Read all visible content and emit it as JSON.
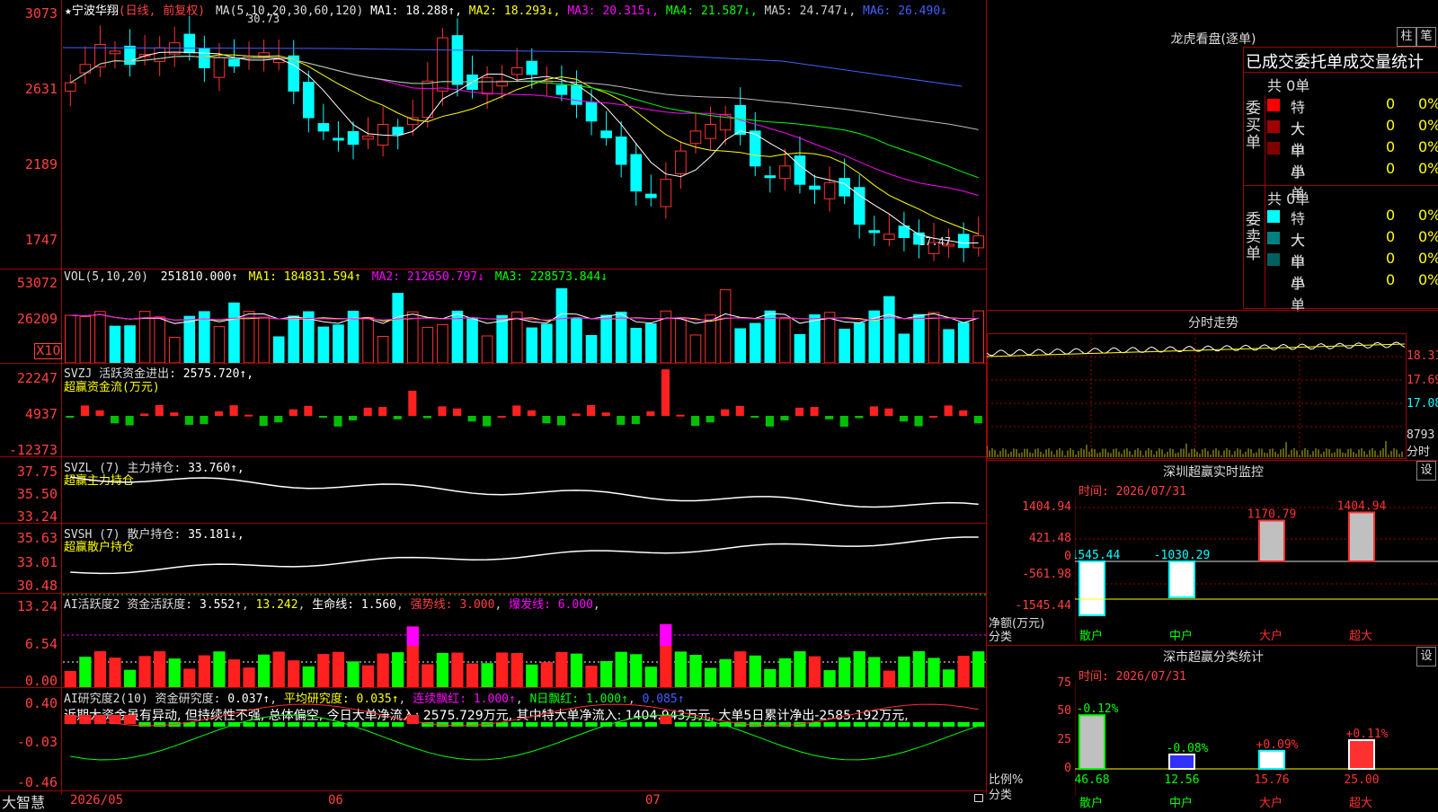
{
  "stock": {
    "name": "★宁波华翔",
    "mode": "(日线, 前复权)"
  },
  "ma_header": {
    "label": "MA(5,10,20,30,60,120)",
    "items": [
      {
        "t": "MA1: 18.288↑",
        "c": "#ffffff"
      },
      {
        "t": "MA2: 18.293↓",
        "c": "#ffff00"
      },
      {
        "t": "MA3: 20.315↓",
        "c": "#ff00ff"
      },
      {
        "t": "MA4: 21.587↓",
        "c": "#00ff00"
      },
      {
        "t": "MA5: 24.747↓",
        "c": "#cccccc"
      },
      {
        "t": "MA6: 26.490↓",
        "c": "#4060ff"
      }
    ]
  },
  "price_axis": [
    "3073",
    "2631",
    "2189",
    "1747"
  ],
  "price_marks": {
    "high": "30.73",
    "low": "17.47"
  },
  "vol": {
    "label": "VOL(5,10,20)",
    "value": "251810.000↑",
    "ma1": "MA1: 184831.594↑",
    "ma2": "MA2: 212650.797↓",
    "ma3": "MA3: 228573.844↓",
    "axis": [
      "53072",
      "26209"
    ],
    "unit": "X10"
  },
  "svzj": {
    "label": "SVZJ  活跃资金进出:",
    "value": "2575.720↑,",
    "sub": "超赢资金流(万元)",
    "axis": [
      "22247",
      "4937",
      "-12373"
    ]
  },
  "svzl": {
    "label": "SVZL (7) 主力持仓:",
    "value": "33.760↑,",
    "sub": "超赢主力持仓",
    "axis": [
      "37.75",
      "35.50",
      "33.24"
    ]
  },
  "svsh": {
    "label": "SVSH (7) 散户持仓:",
    "value": "35.181↓,",
    "sub": "超赢散户持仓",
    "axis": [
      "35.63",
      "33.01",
      "30.48"
    ]
  },
  "ai_act": {
    "label": "AI活跃度2 资金活跃度:",
    "v1": "3.552↑",
    "v2": "13.242",
    "v3": "生命线: 1.560",
    "v4": "强势线: 3.000",
    "v5": "爆发线: 6.000",
    "axis": [
      "13.24",
      "6.54",
      "0.00"
    ]
  },
  "ai_res": {
    "label": "AI研究度2(10) 资金研究度:",
    "v1": "0.037↑",
    "v2": "平均研究度: 0.035↑",
    "v3": "连续飘红: 1.000↑",
    "v4": "N日飘红: 1.000↑",
    "v5": "0.085↑",
    "axis": [
      "0.40",
      "-0.03",
      "-0.46"
    ],
    "comment": "近期大资金虽有异动, 但持续性不强, 总体偏空, 今日大单净流入: 2575.729万元, 其中特大单净流入: 1404.943万元, 大单5日累计净出-2585.192万元,"
  },
  "date_axis": [
    "2026/05",
    "06",
    "07"
  ],
  "brand": "大智慧",
  "right": {
    "lhb_title": "龙虎看盘(逐单)",
    "btn1": "柱",
    "btn2": "笔",
    "stat_title": "已成交委托单成交量统计",
    "buy_label": "委买单",
    "sell_label": "委卖单",
    "buy_total": "共 0单",
    "sell_total": "共 0单",
    "buy_rows": [
      {
        "n": "特大",
        "v": "0",
        "p": "0%",
        "c": "#ff0000"
      },
      {
        "n": "大单",
        "v": "0",
        "p": "0%",
        "c": "#a00000"
      },
      {
        "n": "中单",
        "v": "0",
        "p": "0%",
        "c": "#800000"
      },
      {
        "n": "小单",
        "v": "0",
        "p": "0%",
        "c": "#000000"
      }
    ],
    "sell_rows": [
      {
        "n": "特大",
        "v": "0",
        "p": "0%",
        "c": "#00ffff"
      },
      {
        "n": "大单",
        "v": "0",
        "p": "0%",
        "c": "#008080"
      },
      {
        "n": "中单",
        "v": "0",
        "p": "0%",
        "c": "#006060"
      },
      {
        "n": "小单",
        "v": "0",
        "p": "0%",
        "c": "#000000"
      }
    ],
    "fs_title": "分时走势",
    "fs_axis": [
      "18.31",
      "17.69",
      "17.08",
      "8793",
      "分时"
    ],
    "sz_title": "深圳超赢实时监控",
    "sz_time": "时间: 2026/07/31",
    "set": "设",
    "sz_axis": [
      "1404.94",
      "421.48",
      "0",
      "-561.98",
      "-1545.44"
    ],
    "sz_bars": [
      {
        "v": "-1545.44",
        "label": "散户"
      },
      {
        "v": "-1030.29",
        "label": "中户"
      },
      {
        "v": "1170.79",
        "label": "大户"
      },
      {
        "v": "1404.94",
        "label": "超大"
      }
    ],
    "sz_yunit": "净额(万元)",
    "sz_xunit": "分类",
    "sc_title": "深市超赢分类统计",
    "sc_time": "时间: 2026/07/31",
    "sc_axis": [
      "75",
      "50",
      "25",
      "0"
    ],
    "sc_bars": [
      {
        "pct": "-0.12%",
        "v": "46.68",
        "label": "散户"
      },
      {
        "pct": "-0.08%",
        "v": "12.56",
        "label": "中户"
      },
      {
        "pct": "+0.09%",
        "v": "15.76",
        "label": "大户"
      },
      {
        "pct": "+0.11%",
        "v": "25.00",
        "label": "超大"
      }
    ],
    "sc_yunit": "比例%",
    "sc_xunit": "分类"
  },
  "colors": {
    "up": "#ff3030",
    "down": "#00ffff",
    "grid": "#a00000"
  }
}
